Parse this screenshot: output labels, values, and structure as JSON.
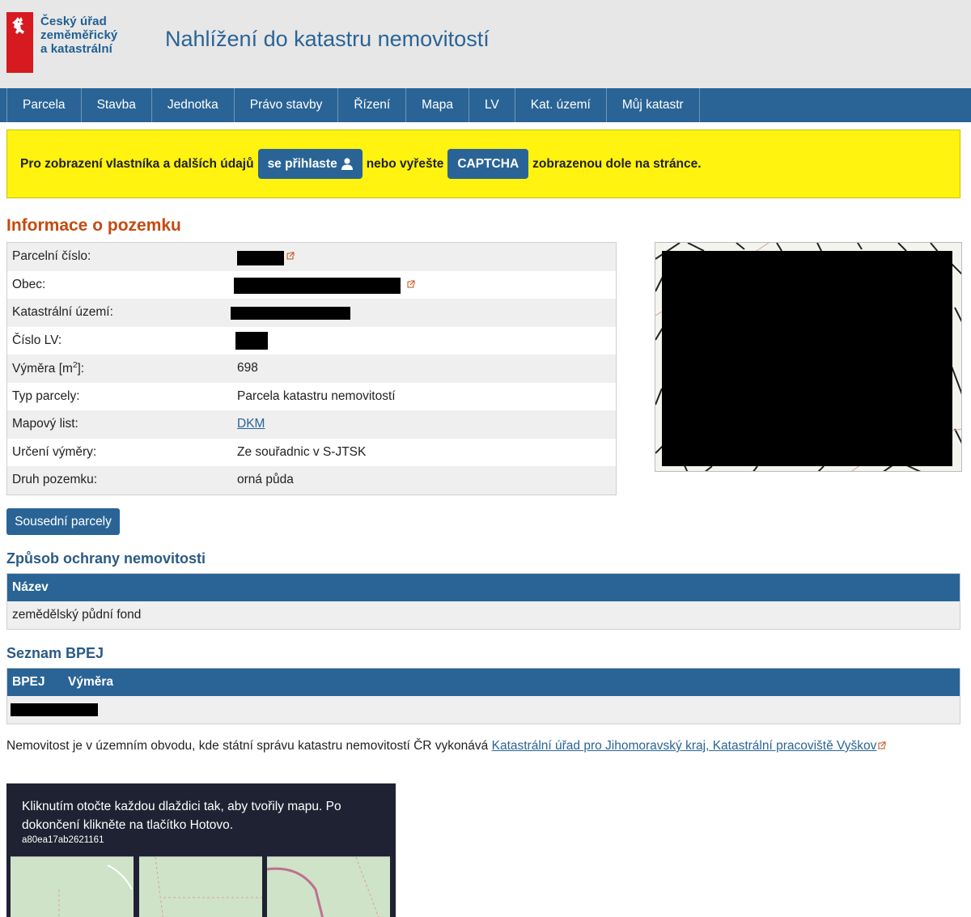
{
  "header": {
    "logo_lines": [
      "Český úřad",
      "zeměměřický",
      "a katastrální"
    ],
    "title": "Nahlížení do katastru nemovitostí"
  },
  "nav": {
    "items": [
      "Parcela",
      "Stavba",
      "Jednotka",
      "Právo stavby",
      "Řízení",
      "Mapa",
      "LV",
      "Kat. území",
      "Můj katastr"
    ]
  },
  "notice": {
    "text_before": "Pro zobrazení vlastníka a dalších údajů",
    "login_button": "se přihlaste",
    "text_middle": "nebo vyřešte",
    "captcha_button": "CAPTCHA",
    "text_after": "zobrazenou dole na stránce."
  },
  "info": {
    "heading": "Informace o pozemku",
    "rows": [
      {
        "label": "Parcelní číslo:",
        "value": ""
      },
      {
        "label": "Obec:",
        "value": ""
      },
      {
        "label": "Katastrální území:",
        "value": ""
      },
      {
        "label": "Číslo LV:",
        "value": ""
      },
      {
        "label": "Výměra [m",
        "label_sup": "2",
        "label_after": "]:",
        "value": "698"
      },
      {
        "label": "Typ parcely:",
        "value": "Parcela katastru nemovitostí"
      },
      {
        "label": "Mapový list:",
        "value": "DKM"
      },
      {
        "label": "Určení výměry:",
        "value": "Ze souřadnic v S-JTSK"
      },
      {
        "label": "Druh pozemku:",
        "value": "orná půda"
      }
    ],
    "neighbors_button": "Sousední parcely"
  },
  "protection": {
    "heading": "Způsob ochrany nemovitosti",
    "column": "Název",
    "rows": [
      "zemědělský půdní fond"
    ]
  },
  "bpej": {
    "heading": "Seznam BPEJ",
    "columns": [
      "BPEJ",
      "Výměra"
    ]
  },
  "footnote": {
    "text": "Nemovitost je v územním obvodu, kde státní správu katastru nemovitostí ČR vykonává",
    "link": "Katastrální úřad pro Jihomoravský kraj, Katastrální pracoviště Vyškov"
  },
  "captcha": {
    "instruction": "Kliknutím otočte každou dlaždici tak, aby tvořily mapu. Po dokončení klikněte na tlačítko Hotovo.",
    "id": "a80ea17ab2621161"
  },
  "colors": {
    "brand_blue": "#2a6496",
    "heading_orange": "#c44a10",
    "notice_yellow": "#fff30f",
    "logo_red": "#d71920"
  }
}
